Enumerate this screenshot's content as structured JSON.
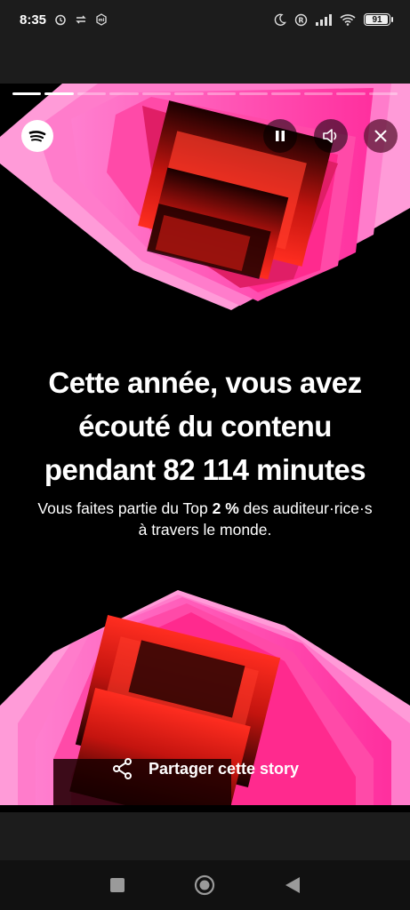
{
  "status_bar": {
    "time": "8:35",
    "battery": "91"
  },
  "story": {
    "segments_total": 12,
    "segments_done": 2,
    "headline": "Cette année, vous avez\nécouté du contenu\npendant 82 114 minutes",
    "sub_pre": "Vous faites partie du Top ",
    "sub_bold": "2 %",
    "sub_post": " des auditeur·rice·s\nà travers le monde.",
    "share_label": "Partager cette story"
  },
  "colors": {
    "pink": "#ff3fae",
    "red": "#e8231a",
    "black": "#000000"
  },
  "icons": {
    "logo": "spotify-icon",
    "pause": "pause-icon",
    "sound": "speaker-icon",
    "close": "close-icon",
    "share": "share-icon"
  }
}
